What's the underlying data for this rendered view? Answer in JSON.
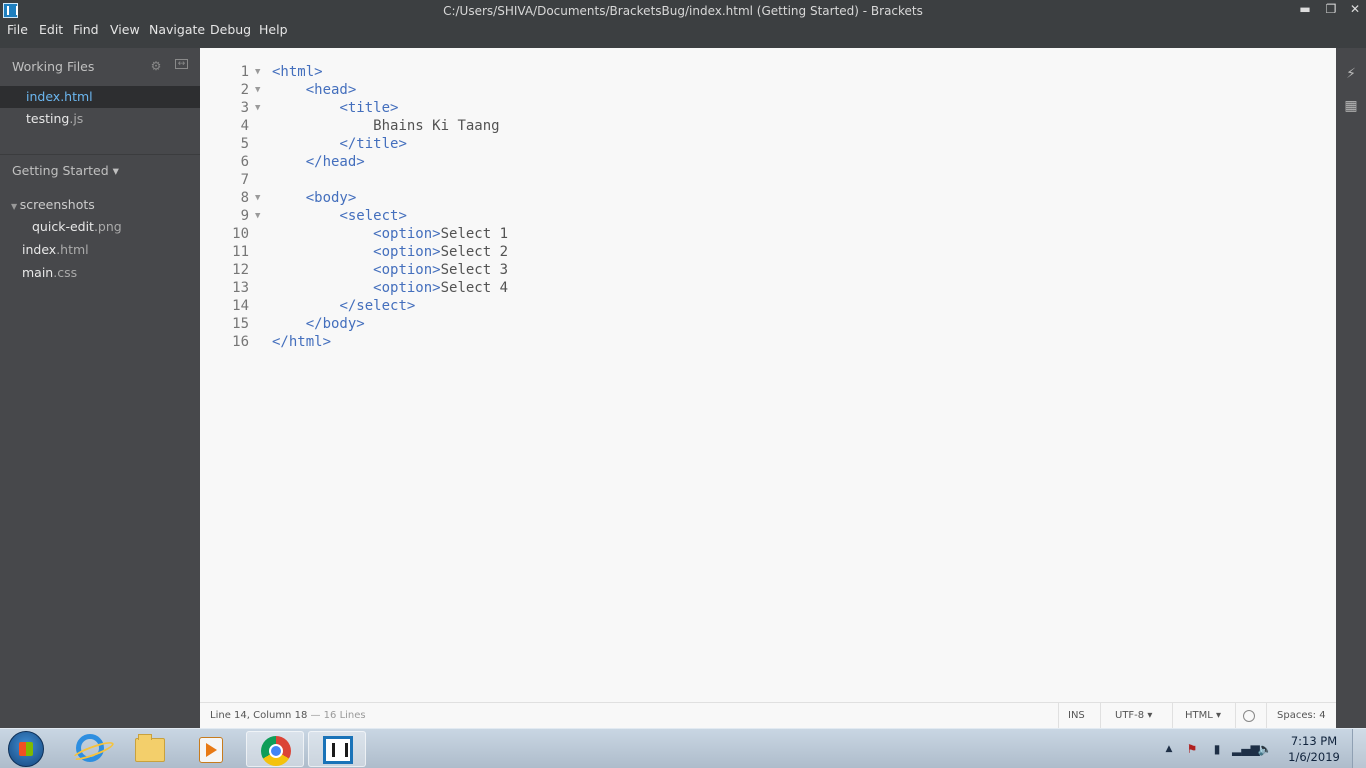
{
  "window": {
    "title": "C:/Users/SHIVA/Documents/BracketsBug/index.html (Getting Started) - Brackets",
    "minimize": "▬",
    "restore": "❐",
    "close": "✕"
  },
  "menu": [
    "File",
    "Edit",
    "Find",
    "View",
    "Navigate",
    "Debug",
    "Help"
  ],
  "sidebar": {
    "working_files_label": "Working Files",
    "working_files": [
      {
        "name": "index",
        "ext": ".html"
      },
      {
        "name": "testing",
        "ext": ".js"
      }
    ],
    "project_label": "Getting Started ▾",
    "tree": {
      "folder": "screenshots",
      "folder_files": [
        {
          "name": "quick-edit",
          "ext": ".png"
        }
      ],
      "files": [
        {
          "name": "index",
          "ext": ".html"
        },
        {
          "name": "main",
          "ext": ".css"
        }
      ]
    }
  },
  "editor": {
    "lines": [
      {
        "n": "1",
        "fold": true,
        "indent": "",
        "parts": [
          {
            "t": "tag",
            "v": "<html>"
          }
        ]
      },
      {
        "n": "2",
        "fold": true,
        "indent": "    ",
        "parts": [
          {
            "t": "tag",
            "v": "<head>"
          }
        ]
      },
      {
        "n": "3",
        "fold": true,
        "indent": "        ",
        "parts": [
          {
            "t": "tag",
            "v": "<title>"
          }
        ]
      },
      {
        "n": "4",
        "fold": false,
        "indent": "            ",
        "parts": [
          {
            "t": "text",
            "v": "Bhains Ki Taang"
          }
        ]
      },
      {
        "n": "5",
        "fold": false,
        "indent": "        ",
        "parts": [
          {
            "t": "tag",
            "v": "</title>"
          }
        ]
      },
      {
        "n": "6",
        "fold": false,
        "indent": "    ",
        "parts": [
          {
            "t": "tag",
            "v": "</head>"
          }
        ]
      },
      {
        "n": "7",
        "fold": false,
        "indent": "",
        "parts": []
      },
      {
        "n": "8",
        "fold": true,
        "indent": "    ",
        "parts": [
          {
            "t": "tag",
            "v": "<body>"
          }
        ]
      },
      {
        "n": "9",
        "fold": true,
        "indent": "        ",
        "parts": [
          {
            "t": "tag",
            "v": "<select>"
          }
        ]
      },
      {
        "n": "10",
        "fold": false,
        "indent": "            ",
        "parts": [
          {
            "t": "tag",
            "v": "<option>"
          },
          {
            "t": "text",
            "v": "Select 1"
          }
        ]
      },
      {
        "n": "11",
        "fold": false,
        "indent": "            ",
        "parts": [
          {
            "t": "tag",
            "v": "<option>"
          },
          {
            "t": "text",
            "v": "Select 2"
          }
        ]
      },
      {
        "n": "12",
        "fold": false,
        "indent": "            ",
        "parts": [
          {
            "t": "tag",
            "v": "<option>"
          },
          {
            "t": "text",
            "v": "Select 3"
          }
        ]
      },
      {
        "n": "13",
        "fold": false,
        "indent": "            ",
        "parts": [
          {
            "t": "tag",
            "v": "<option>"
          },
          {
            "t": "text",
            "v": "Select 4"
          }
        ]
      },
      {
        "n": "14",
        "fold": false,
        "indent": "        ",
        "parts": [
          {
            "t": "tag",
            "v": "</select>"
          }
        ]
      },
      {
        "n": "15",
        "fold": false,
        "indent": "    ",
        "parts": [
          {
            "t": "tag",
            "v": "</body>"
          }
        ]
      },
      {
        "n": "16",
        "fold": false,
        "indent": "",
        "parts": [
          {
            "t": "tag",
            "v": "</html>"
          }
        ]
      }
    ]
  },
  "status": {
    "cursor": "Line 14, Column 18",
    "line_count": "— 16 Lines",
    "mode": "INS",
    "encoding": "UTF-8 ▾",
    "language": "HTML ▾",
    "spaces": "Spaces:  4"
  },
  "taskbar": {
    "apps": [
      "start-orb",
      "internet-explorer",
      "file-explorer",
      "media-player",
      "chrome",
      "brackets"
    ],
    "clock_time": "7:13 PM",
    "clock_date": "1/6/2019"
  },
  "colors": {
    "tag": "#446fbd",
    "text": "#535353",
    "sidebar_bg": "#47484b",
    "editor_bg": "#f8f8f8"
  }
}
